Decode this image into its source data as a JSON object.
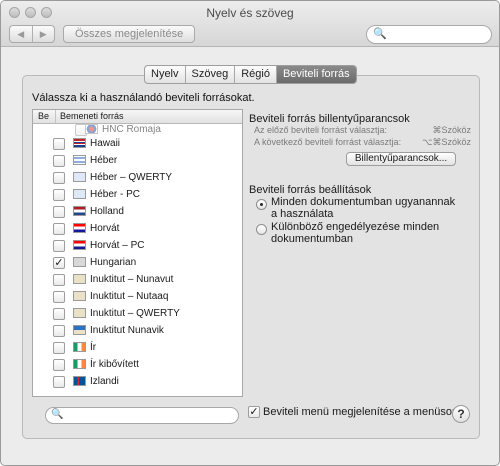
{
  "window": {
    "title": "Nyelv és szöveg",
    "show_all_label": "Összes megjelenítése",
    "nav_back_glyph": "◀",
    "nav_forward_glyph": "▶",
    "search_icon_glyph": "🔍"
  },
  "tabs": [
    {
      "label": "Nyelv",
      "active": false
    },
    {
      "label": "Szöveg",
      "active": false
    },
    {
      "label": "Régió",
      "active": false
    },
    {
      "label": "Beviteli forrás",
      "active": true
    }
  ],
  "instruction": "Válassza ki a használandó beviteli forrásokat.",
  "list": {
    "col_on": "Be",
    "col_source": "Bemeneti forrás",
    "items": [
      {
        "label": "HNC Romaja",
        "checked": false,
        "flag": "hnc",
        "partial": true
      },
      {
        "label": "Hawaii",
        "checked": false,
        "flag": "hawaii"
      },
      {
        "label": "Héber",
        "checked": false,
        "flag": "israel"
      },
      {
        "label": "Héber – QWERTY",
        "checked": false,
        "flag": "israel-alt"
      },
      {
        "label": "Héber - PC",
        "checked": false,
        "flag": "israel-alt"
      },
      {
        "label": "Holland",
        "checked": false,
        "flag": "netherlands"
      },
      {
        "label": "Horvát",
        "checked": false,
        "flag": "croatia"
      },
      {
        "label": "Horvát – PC",
        "checked": false,
        "flag": "croatia"
      },
      {
        "label": "Hungarian",
        "checked": true,
        "flag": "keyboard"
      },
      {
        "label": "Inuktitut – Nunavut",
        "checked": false,
        "flag": "inuktitut"
      },
      {
        "label": "Inuktitut – Nutaaq",
        "checked": false,
        "flag": "inuktitut"
      },
      {
        "label": "Inuktitut – QWERTY",
        "checked": false,
        "flag": "inuktitut"
      },
      {
        "label": "Inuktitut Nunavik",
        "checked": false,
        "flag": "inuktitut-nunavik"
      },
      {
        "label": "Ír",
        "checked": false,
        "flag": "ireland"
      },
      {
        "label": "Ír kibővített",
        "checked": false,
        "flag": "ireland"
      },
      {
        "label": "Izlandi",
        "checked": false,
        "flag": "iceland"
      }
    ]
  },
  "shortcuts": {
    "heading": "Beviteli forrás billentyűparancsok",
    "prev_label": "Az előző beviteli forrást választja:",
    "prev_key": "⌘Szóköz",
    "next_label": "A következő beviteli forrást választja:",
    "next_key": "⌥⌘Szóköz",
    "button_label": "Billentyűparancsok..."
  },
  "settings": {
    "heading": "Beviteli forrás beállítások",
    "option1_line1": "Minden dokumentumban ugyanannak",
    "option1_line2": "a használata",
    "option2_line1": "Különböző engedélyezése minden",
    "option2_line2": "dokumentumban",
    "selected": 1
  },
  "footer": {
    "show_menu_label": "Beviteli menü megjelenítése a menüsoron",
    "show_menu_checked": true,
    "help_glyph": "?"
  },
  "colors": {
    "window_bg": "#ececec",
    "panel_bg": "#e3e3e3",
    "active_tab": "#7a7a7a"
  }
}
